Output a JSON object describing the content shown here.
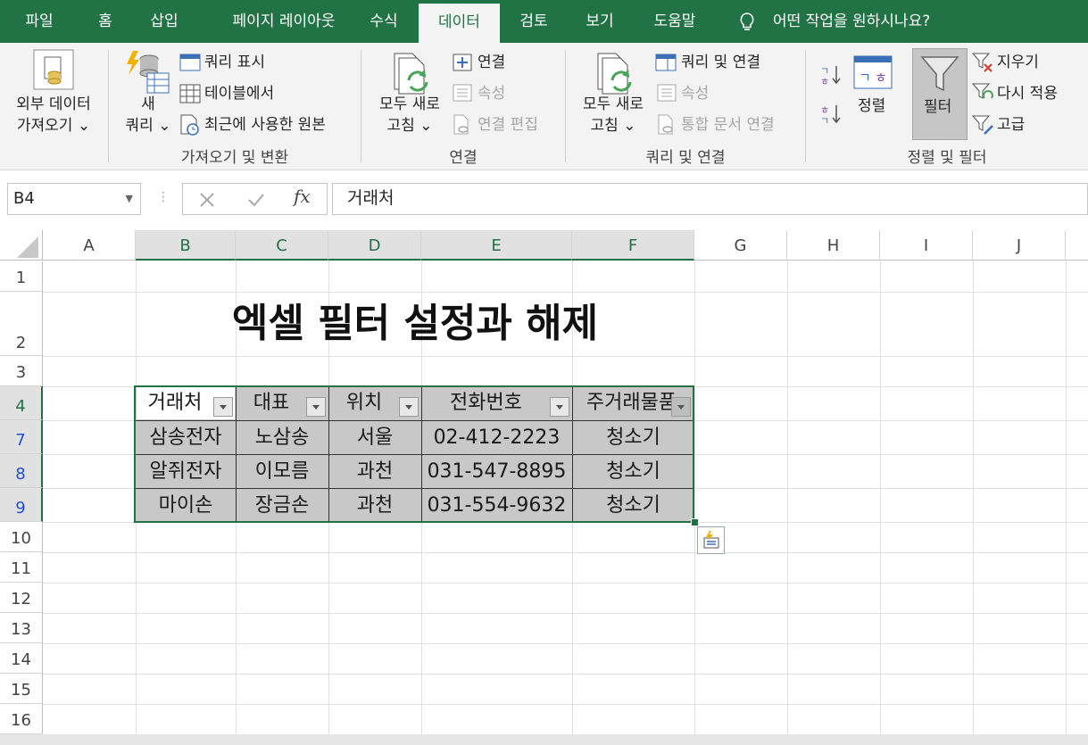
{
  "tabs": [
    "파일",
    "홈",
    "삽입",
    "페이지 레이아웃",
    "수식",
    "데이터",
    "검토",
    "보기",
    "도움말"
  ],
  "active_tab": "데이터",
  "tell_me": "어떤 작업을 원하시나요?",
  "ribbon": {
    "get_external_data": [
      "외부 데이터",
      "가져오기 ⌄"
    ],
    "new_query": [
      "새",
      "쿼리 ⌄"
    ],
    "show_queries": "쿼리 표시",
    "from_table": "테이블에서",
    "recent_sources": "최근에 사용한 원본",
    "group_get_transform": "가져오기 및 변환",
    "refresh_all_1": [
      "모두 새로",
      "고침 ⌄"
    ],
    "connections": "연결",
    "properties_1": "속성",
    "edit_links": "연결 편집",
    "group_connections": "연결",
    "refresh_all_2": [
      "모두 새로",
      "고침 ⌄"
    ],
    "queries_connections": "쿼리 및 연결",
    "properties_2": "속성",
    "workbook_links": "통합 문서 연결",
    "group_queries_connections": "쿼리 및 연결",
    "sort": "정렬",
    "filter": "필터",
    "clear": "지우기",
    "reapply": "다시 적용",
    "advanced": "고급",
    "group_sort_filter": "정렬 및 필터"
  },
  "name_box": "B4",
  "formula": "거래처",
  "columns": [
    "A",
    "B",
    "C",
    "D",
    "E",
    "F",
    "G",
    "H",
    "I",
    "J"
  ],
  "rows": [
    "1",
    "2",
    "3",
    "4",
    "7",
    "8",
    "9",
    "10",
    "11",
    "12",
    "13",
    "14",
    "15",
    "16"
  ],
  "sheet_title": "엑셀 필터 설정과 해제",
  "table": {
    "headers": [
      "거래처",
      "대표",
      "위치",
      "전화번호",
      "주거래물품"
    ],
    "rows": [
      [
        "삼송전자",
        "노삼송",
        "서울",
        "02-412-2223",
        "청소기"
      ],
      [
        "알쥐전자",
        "이모름",
        "과천",
        "031-547-8895",
        "청소기"
      ],
      [
        "마이손",
        "장금손",
        "과천",
        "031-554-9632",
        "청소기"
      ]
    ]
  },
  "colors": {
    "accent": "#217346",
    "selection": "#bfbfbf",
    "filtered_row_number": "#1f4fd6"
  }
}
